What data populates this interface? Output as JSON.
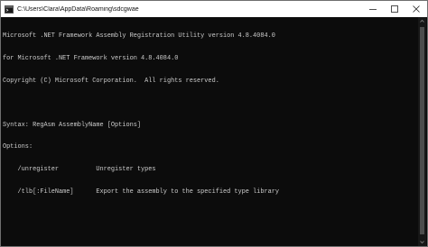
{
  "window": {
    "title": "C:\\Users\\Clara\\AppData\\Roaming\\sdcgwae"
  },
  "icons": {
    "app": "console-icon",
    "minimize": "minimize-icon",
    "maximize": "maximize-icon",
    "close": "close-icon"
  },
  "colors": {
    "console_bg": "#0c0c0c",
    "console_text": "#cccccc",
    "titlebar_bg": "#ffffff"
  },
  "console": {
    "lines": [
      "Microsoft .NET Framework Assembly Registration Utility version 4.8.4084.0",
      "for Microsoft .NET Framework version 4.8.4084.0",
      "Copyright (C) Microsoft Corporation.  All rights reserved.",
      "",
      "Syntax: RegAsm AssemblyName [Options]",
      "Options:",
      "    /unregister          Unregister types",
      "    /tlb[:FileName]      Export the assembly to the specified type library"
    ]
  }
}
